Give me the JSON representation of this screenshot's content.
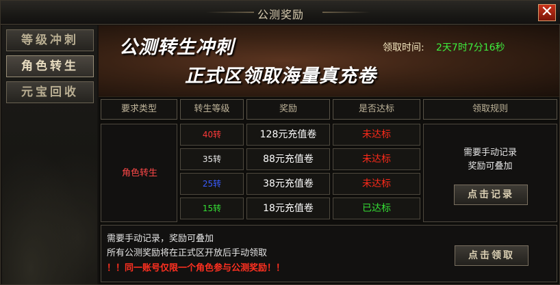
{
  "window": {
    "title": "公测奖励",
    "close_symbol": "✕"
  },
  "sidebar": {
    "tabs": [
      {
        "label": "等级冲刺"
      },
      {
        "label": "角色转生"
      },
      {
        "label": "元宝回收"
      }
    ],
    "active_index": 1
  },
  "banner": {
    "title_line1": "公测转生冲刺",
    "title_line2": "正式区领取海量真充卷",
    "time_label": "领取时间:",
    "time_value": "2天7时7分16秒"
  },
  "table": {
    "headers": [
      "要求类型",
      "转生等级",
      "奖励",
      "是否达标",
      "领取规则"
    ],
    "requirement_type": "角色转生",
    "rows": [
      {
        "level": "40转",
        "level_color": "#ff3a3a",
        "reward": "128元充值卷",
        "status": "未达标",
        "status_color": "#ff2a1a"
      },
      {
        "level": "35转",
        "level_color": "#e8e8e8",
        "reward": "88元充值卷",
        "status": "未达标",
        "status_color": "#ff2a1a"
      },
      {
        "level": "25转",
        "level_color": "#3a5cff",
        "reward": "38元充值卷",
        "status": "未达标",
        "status_color": "#ff2a1a"
      },
      {
        "level": "15转",
        "level_color": "#35e035",
        "reward": "18元充值卷",
        "status": "已达标",
        "status_color": "#35e035"
      }
    ],
    "rule_line1": "需要手动记录",
    "rule_line2": "奖励可叠加",
    "record_button": "点击记录"
  },
  "notice": {
    "line1": "需要手动记录，奖励可叠加",
    "line2": "所有公测奖励将在正式区开放后手动领取",
    "warning": "！！同一账号仅限一个角色参与公测奖励！！",
    "claim_button": "点击领取"
  }
}
